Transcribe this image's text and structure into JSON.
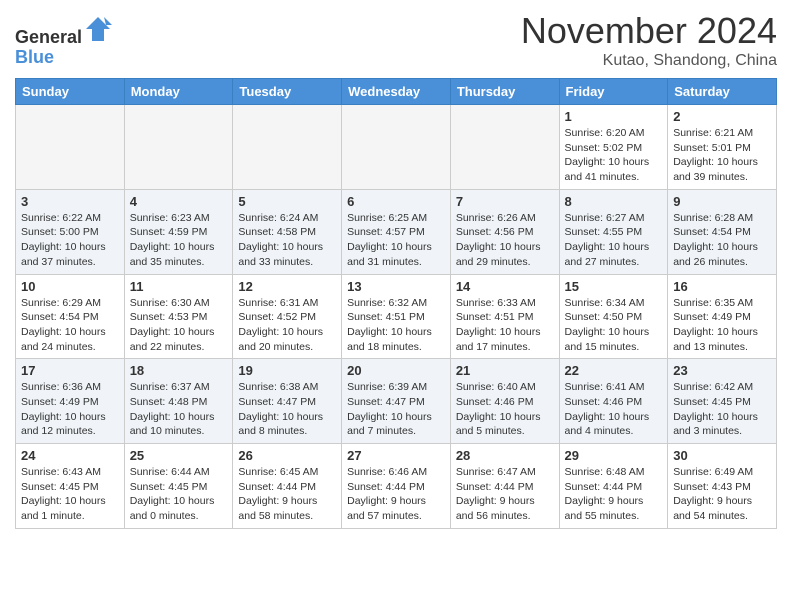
{
  "header": {
    "logo_line1": "General",
    "logo_line2": "Blue",
    "month_title": "November 2024",
    "subtitle": "Kutao, Shandong, China"
  },
  "days_of_week": [
    "Sunday",
    "Monday",
    "Tuesday",
    "Wednesday",
    "Thursday",
    "Friday",
    "Saturday"
  ],
  "weeks": [
    [
      {
        "day": "",
        "info": ""
      },
      {
        "day": "",
        "info": ""
      },
      {
        "day": "",
        "info": ""
      },
      {
        "day": "",
        "info": ""
      },
      {
        "day": "",
        "info": ""
      },
      {
        "day": "1",
        "info": "Sunrise: 6:20 AM\nSunset: 5:02 PM\nDaylight: 10 hours and 41 minutes."
      },
      {
        "day": "2",
        "info": "Sunrise: 6:21 AM\nSunset: 5:01 PM\nDaylight: 10 hours and 39 minutes."
      }
    ],
    [
      {
        "day": "3",
        "info": "Sunrise: 6:22 AM\nSunset: 5:00 PM\nDaylight: 10 hours and 37 minutes."
      },
      {
        "day": "4",
        "info": "Sunrise: 6:23 AM\nSunset: 4:59 PM\nDaylight: 10 hours and 35 minutes."
      },
      {
        "day": "5",
        "info": "Sunrise: 6:24 AM\nSunset: 4:58 PM\nDaylight: 10 hours and 33 minutes."
      },
      {
        "day": "6",
        "info": "Sunrise: 6:25 AM\nSunset: 4:57 PM\nDaylight: 10 hours and 31 minutes."
      },
      {
        "day": "7",
        "info": "Sunrise: 6:26 AM\nSunset: 4:56 PM\nDaylight: 10 hours and 29 minutes."
      },
      {
        "day": "8",
        "info": "Sunrise: 6:27 AM\nSunset: 4:55 PM\nDaylight: 10 hours and 27 minutes."
      },
      {
        "day": "9",
        "info": "Sunrise: 6:28 AM\nSunset: 4:54 PM\nDaylight: 10 hours and 26 minutes."
      }
    ],
    [
      {
        "day": "10",
        "info": "Sunrise: 6:29 AM\nSunset: 4:54 PM\nDaylight: 10 hours and 24 minutes."
      },
      {
        "day": "11",
        "info": "Sunrise: 6:30 AM\nSunset: 4:53 PM\nDaylight: 10 hours and 22 minutes."
      },
      {
        "day": "12",
        "info": "Sunrise: 6:31 AM\nSunset: 4:52 PM\nDaylight: 10 hours and 20 minutes."
      },
      {
        "day": "13",
        "info": "Sunrise: 6:32 AM\nSunset: 4:51 PM\nDaylight: 10 hours and 18 minutes."
      },
      {
        "day": "14",
        "info": "Sunrise: 6:33 AM\nSunset: 4:51 PM\nDaylight: 10 hours and 17 minutes."
      },
      {
        "day": "15",
        "info": "Sunrise: 6:34 AM\nSunset: 4:50 PM\nDaylight: 10 hours and 15 minutes."
      },
      {
        "day": "16",
        "info": "Sunrise: 6:35 AM\nSunset: 4:49 PM\nDaylight: 10 hours and 13 minutes."
      }
    ],
    [
      {
        "day": "17",
        "info": "Sunrise: 6:36 AM\nSunset: 4:49 PM\nDaylight: 10 hours and 12 minutes."
      },
      {
        "day": "18",
        "info": "Sunrise: 6:37 AM\nSunset: 4:48 PM\nDaylight: 10 hours and 10 minutes."
      },
      {
        "day": "19",
        "info": "Sunrise: 6:38 AM\nSunset: 4:47 PM\nDaylight: 10 hours and 8 minutes."
      },
      {
        "day": "20",
        "info": "Sunrise: 6:39 AM\nSunset: 4:47 PM\nDaylight: 10 hours and 7 minutes."
      },
      {
        "day": "21",
        "info": "Sunrise: 6:40 AM\nSunset: 4:46 PM\nDaylight: 10 hours and 5 minutes."
      },
      {
        "day": "22",
        "info": "Sunrise: 6:41 AM\nSunset: 4:46 PM\nDaylight: 10 hours and 4 minutes."
      },
      {
        "day": "23",
        "info": "Sunrise: 6:42 AM\nSunset: 4:45 PM\nDaylight: 10 hours and 3 minutes."
      }
    ],
    [
      {
        "day": "24",
        "info": "Sunrise: 6:43 AM\nSunset: 4:45 PM\nDaylight: 10 hours and 1 minute."
      },
      {
        "day": "25",
        "info": "Sunrise: 6:44 AM\nSunset: 4:45 PM\nDaylight: 10 hours and 0 minutes."
      },
      {
        "day": "26",
        "info": "Sunrise: 6:45 AM\nSunset: 4:44 PM\nDaylight: 9 hours and 58 minutes."
      },
      {
        "day": "27",
        "info": "Sunrise: 6:46 AM\nSunset: 4:44 PM\nDaylight: 9 hours and 57 minutes."
      },
      {
        "day": "28",
        "info": "Sunrise: 6:47 AM\nSunset: 4:44 PM\nDaylight: 9 hours and 56 minutes."
      },
      {
        "day": "29",
        "info": "Sunrise: 6:48 AM\nSunset: 4:44 PM\nDaylight: 9 hours and 55 minutes."
      },
      {
        "day": "30",
        "info": "Sunrise: 6:49 AM\nSunset: 4:43 PM\nDaylight: 9 hours and 54 minutes."
      }
    ]
  ]
}
